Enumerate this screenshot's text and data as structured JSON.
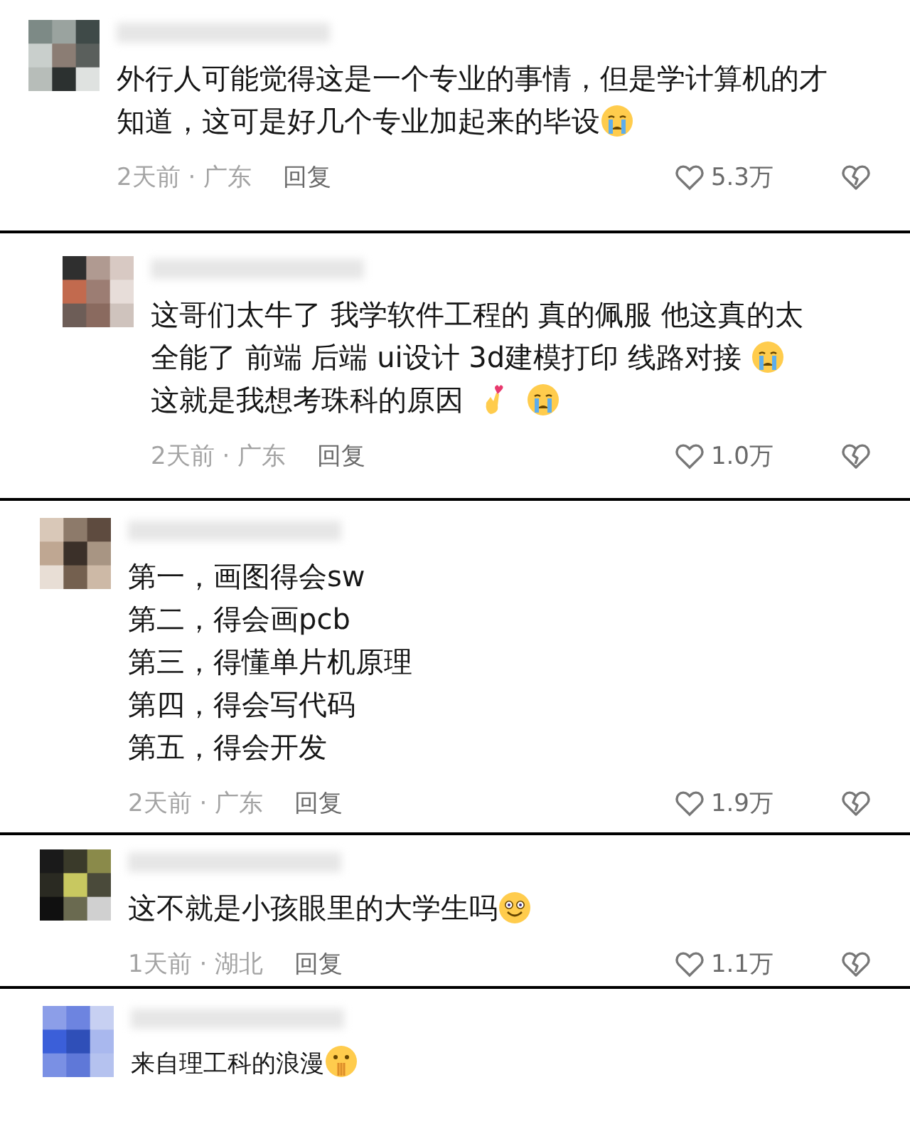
{
  "comments": [
    {
      "body": [
        {
          "kind": "text",
          "text": "外行人可能觉得这是一个专业的事情，但是学计算机的才知道，这可是好几个专业加起来的毕设"
        },
        {
          "kind": "emoji-cry"
        }
      ],
      "time": "2天前 · 广东",
      "reply": "回复",
      "likes": "5.3万"
    },
    {
      "body": [
        {
          "kind": "text",
          "text": "这哥们太牛了 我学软件工程的 真的佩服 他这真的太全能了 前端 后端 ui设计 3d建模打印 线路对接 "
        },
        {
          "kind": "emoji-cry"
        },
        {
          "kind": "text",
          "text": "这就是我想考珠科的原因"
        },
        {
          "kind": "emoji-heart-fingers"
        },
        {
          "kind": "emoji-cry"
        }
      ],
      "time": "2天前 · 广东",
      "reply": "回复",
      "likes": "1.0万"
    },
    {
      "body": [
        {
          "kind": "line",
          "text": "第一，画图得会sw"
        },
        {
          "kind": "line",
          "text": "第二，得会画pcb"
        },
        {
          "kind": "line",
          "text": "第三，得懂单片机原理"
        },
        {
          "kind": "line",
          "text": "第四，得会写代码"
        },
        {
          "kind": "line",
          "text": "第五，得会开发"
        }
      ],
      "time": "2天前 · 广东",
      "reply": "回复",
      "likes": "1.9万"
    },
    {
      "body": [
        {
          "kind": "text",
          "text": "这不就是小孩眼里的大学生吗"
        },
        {
          "kind": "emoji-dizzy"
        }
      ],
      "time": "1天前 · 湖北",
      "reply": "回复",
      "likes": "1.1万"
    },
    {
      "body": [
        {
          "kind": "text",
          "text": "来自理工科的浪漫"
        },
        {
          "kind": "emoji-shush"
        }
      ]
    }
  ]
}
